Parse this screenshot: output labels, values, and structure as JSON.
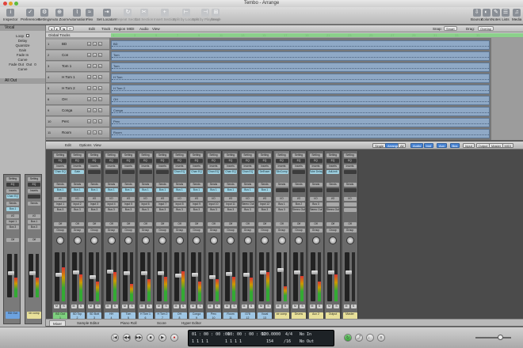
{
  "window": {
    "title": "Tembo - Arrange"
  },
  "toolbar": {
    "left": [
      {
        "label": "Inspector",
        "icon": "i"
      },
      {
        "label": "Preferences",
        "icon": "✓"
      },
      {
        "label": "Settings",
        "icon": "⚙"
      }
    ],
    "mid": [
      {
        "label": "Auto Zoom",
        "icon": "⊕"
      },
      {
        "label": "Automation",
        "icon": "⌇"
      },
      {
        "label": "Flex",
        "icon": "≈"
      }
    ],
    "edit": [
      {
        "label": "Set Locators",
        "icon": "⇥"
      },
      {
        "label": "Repeat Section",
        "icon": "↻"
      },
      {
        "label": "Cut Section",
        "icon": "✂"
      },
      {
        "label": "Insert Section",
        "icon": "+"
      },
      {
        "label": "Split by Locators",
        "icon": "⊢"
      },
      {
        "label": "Split by Playhead",
        "icon": "⊣"
      },
      {
        "label": "Merge",
        "icon": "⊞"
      }
    ],
    "right": [
      {
        "label": "Bounce",
        "icon": "⇩"
      },
      {
        "label": "Colors",
        "icon": "◐"
      },
      {
        "label": "Notes",
        "icon": "✎"
      },
      {
        "label": "Lists",
        "icon": "☰"
      },
      {
        "label": "Media",
        "icon": "♫"
      }
    ]
  },
  "inspector": {
    "region_label": "Vocal",
    "params": [
      "Loop",
      "Delay",
      "Quantize",
      "Gain",
      "Fade In",
      "Curve",
      "Fade Out",
      "Curve"
    ],
    "fadeout_values": [
      "Out",
      "0"
    ],
    "param_values": [
      "",
      "",
      "",
      "",
      "",
      "",
      "",
      ""
    ],
    "track_label": "All Out",
    "left_strip": {
      "setting": "Setting",
      "eq": "EQ",
      "inserts": "Inserts",
      "plugin": "Chan EQ",
      "sends": "Sends",
      "send": "Bus 1",
      "io": "I/O",
      "input": "Input 1",
      "output": "Bus 3",
      "auto": "Off",
      "group": "Group",
      "name": "BD Out"
    },
    "right_strip": {
      "setting": "Setting",
      "eq": "EQ",
      "inserts": "Inserts",
      "plugin": "",
      "sends": "Sends",
      "io": "I/O",
      "input": "Bus 1",
      "output": "Bus 3",
      "auto": "Off",
      "name": "ldr comp"
    }
  },
  "arrange": {
    "menus": [
      "Edit",
      "Track",
      "Region",
      "MIDI",
      "Audio",
      "View"
    ],
    "snap_label": "Snap:",
    "snap_value": "Smart",
    "drag_label": "Drag:",
    "drag_value": "Overlap",
    "global_tracks": "Global Tracks",
    "ruler": [
      "1",
      "3",
      "5",
      "7",
      "9",
      "11",
      "13",
      "15",
      "17",
      "19",
      "21",
      "23",
      "25",
      "27",
      "29",
      "31",
      "33",
      "35"
    ],
    "tracks": [
      {
        "num": "1",
        "name": "BD",
        "region": "BD"
      },
      {
        "num": "2",
        "name": "Con",
        "region": "Tom"
      },
      {
        "num": "3",
        "name": "Tom 1",
        "region": "Tom"
      },
      {
        "num": "4",
        "name": "H Tom 1",
        "region": "H Tom"
      },
      {
        "num": "5",
        "name": "H Tom 2",
        "region": "H Tom 2"
      },
      {
        "num": "6",
        "name": "OH",
        "region": "OH"
      },
      {
        "num": "9",
        "name": "Conga",
        "region": "Conga"
      },
      {
        "num": "10",
        "name": "Perc",
        "region": "Perc"
      },
      {
        "num": "11",
        "name": "Room",
        "region": "Room"
      }
    ]
  },
  "mixer": {
    "menus": [
      "Edit",
      "Options",
      "View"
    ],
    "mode_buttons": [
      "Single",
      "Arrange",
      "All"
    ],
    "filter_buttons": [
      "Audio",
      "Inst",
      "Aux",
      "Bus",
      "Input",
      "Output",
      "Master",
      "MIDI"
    ],
    "row_labels": {
      "setting": "Setting",
      "eq": "EQ",
      "inserts": "Inserts",
      "sends": "Sends",
      "io": "I/O",
      "auto": "Off",
      "group": "Group"
    },
    "strips": [
      {
        "insert": "Chan EQ",
        "send": "Bus 1",
        "input": "Input 1",
        "output": "Bus 3",
        "name": "BD Out",
        "num": "1",
        "color": "#7ed07e",
        "level": 0.55,
        "meter": 0.7,
        "pan": "0"
      },
      {
        "insert": "Gate",
        "send": "Bus 1",
        "input": "Input 2",
        "output": "Bus 3",
        "name": "SD Top",
        "num": "2",
        "color": "#9fc6e4",
        "level": 0.6,
        "meter": 0.55,
        "pan": "0"
      },
      {
        "insert": "",
        "send": "Bus 1",
        "input": "Input 3",
        "output": "Bus 3",
        "name": "SD Bott",
        "num": "3",
        "color": "#9fc6e4",
        "level": 0.5,
        "meter": 0.4,
        "pan": "0"
      },
      {
        "insert": "",
        "send": "Bus 1",
        "input": "Input 4",
        "output": "Bus 3",
        "name": "HH",
        "num": "4",
        "color": "#9fc6e4",
        "level": 0.62,
        "meter": 0.6,
        "pan": "-18"
      },
      {
        "insert": "",
        "send": "Bus 1",
        "input": "Input 5",
        "output": "Bus 3",
        "name": "Tom",
        "num": "5",
        "color": "#9fc6e4",
        "level": 0.58,
        "meter": 0.35,
        "pan": "0"
      },
      {
        "insert": "",
        "send": "Bus 1",
        "input": "Input 6",
        "output": "Bus 3",
        "name": "H Tom 1",
        "num": "6",
        "color": "#9fc6e4",
        "level": 0.58,
        "meter": 0.45,
        "pan": "0"
      },
      {
        "insert": "",
        "send": "Bus 1",
        "input": "Input 7",
        "output": "Bus 3",
        "name": "H Tom 2",
        "num": "7",
        "color": "#9fc6e4",
        "level": 0.58,
        "meter": 0.5,
        "pan": "0"
      },
      {
        "insert": "Chan EQ",
        "send": "Bus 1",
        "input": "Input 8",
        "output": "Bus 3",
        "name": "OH",
        "num": "8",
        "color": "#9fc6e4",
        "level": 0.52,
        "meter": 0.62,
        "pan": "0"
      },
      {
        "insert": "Chan EQ",
        "send": "Bus 1",
        "input": "Input 9",
        "output": "Bus 3",
        "name": "Conga",
        "num": "9",
        "color": "#9fc6e4",
        "level": 0.55,
        "meter": 0.4,
        "pan": "0"
      },
      {
        "insert": "Chan EQ",
        "send": "Bus 1",
        "input": "Input 10",
        "output": "Bus 3",
        "name": "Perc",
        "num": "10",
        "color": "#9fc6e4",
        "level": 0.5,
        "meter": 0.45,
        "pan": "0"
      },
      {
        "insert": "Chan EQ",
        "send": "Bus 1",
        "input": "Input 11",
        "output": "Bus 3",
        "name": "Room",
        "num": "11",
        "color": "#9fc6e4",
        "level": 0.57,
        "meter": 0.5,
        "pan": "0"
      },
      {
        "insert": "Chan EQ",
        "send": "Bus 1",
        "input": "Stereo Out",
        "output": "Bus 3",
        "name": "O78",
        "num": "12",
        "color": "#9fc6e4",
        "level": 0.55,
        "meter": 0.48,
        "pan": "0"
      },
      {
        "insert": "DeEsser",
        "send": "Bus 1",
        "input": "Input 12",
        "output": "Bus 3",
        "name": "Vocal",
        "num": "13",
        "color": "#9fc6e4",
        "level": 0.6,
        "meter": 0.6,
        "pan": "0"
      },
      {
        "insert": "SilvComp",
        "send": "",
        "input": "Bus 1",
        "output": "Bus 3",
        "name": "ldr comp",
        "num": "",
        "color": "#e8e09a",
        "level": 0.65,
        "meter": 0.3,
        "pan": "0"
      },
      {
        "insert": "",
        "send": "",
        "input": "Bus 2",
        "output": "Stereo Out",
        "name": "Drums",
        "num": "",
        "color": "#e8e09a",
        "level": 0.6,
        "meter": 0.52,
        "pan": "0"
      },
      {
        "insert": "Tube Delay",
        "send": "",
        "input": "Bus 3",
        "output": "Stereo Out",
        "name": "Aux 2",
        "num": "",
        "color": "#e8e09a",
        "level": 0.6,
        "meter": 0.4,
        "pan": "0"
      },
      {
        "insert": "AdLimit",
        "send": "",
        "input": "",
        "output": "Stereo Out",
        "name": "Output",
        "num": "",
        "color": "#e8e09a",
        "level": 0.6,
        "meter": 0.55,
        "pan": "0"
      },
      {
        "insert": "",
        "send": "",
        "input": "",
        "output": "",
        "name": "Master",
        "num": "",
        "color": "#e8e09a",
        "level": 0.6,
        "meter": 0.0,
        "pan": ""
      }
    ]
  },
  "bottom_tabs": [
    "Mixer",
    "Sample Editor",
    "Piano Roll",
    "Score",
    "Hyper Editor"
  ],
  "transport": {
    "smpte": "01 : 00 : 00 : 00",
    "smpte2": "01 : 00 : 00 : 00",
    "bars": "1   1   1   1",
    "bars2": "1   1   1   1",
    "tempo": "120.0000",
    "tempo2": "154",
    "sig": "4/4",
    "sig2": "/16",
    "in": "No In",
    "out": "No Out",
    "buttons": [
      "|◀",
      "◀◀",
      "▶▶",
      "■",
      "▶",
      "●",
      "↻",
      "⤴",
      "♩",
      "≡"
    ]
  }
}
